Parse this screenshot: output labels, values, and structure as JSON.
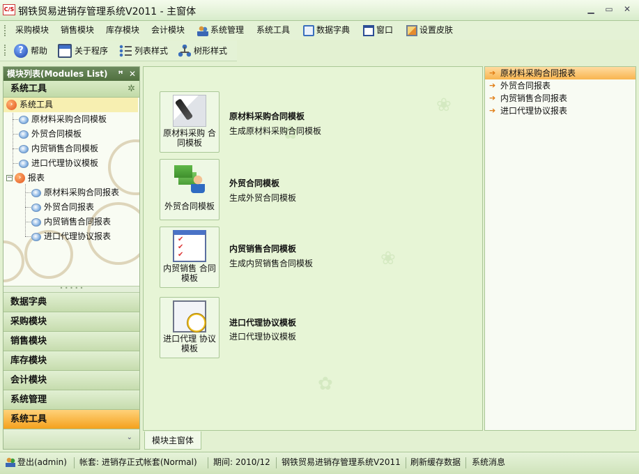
{
  "window": {
    "logo": "C/S",
    "title": "钢铁贸易进销存管理系统V2011 - 主窗体"
  },
  "menu": [
    {
      "label": "采购模块"
    },
    {
      "label": "销售模块"
    },
    {
      "label": "库存模块"
    },
    {
      "label": "会计模块"
    },
    {
      "label": "系统管理",
      "icon": "users-icon"
    },
    {
      "label": "系统工具"
    },
    {
      "label": "数据字典",
      "icon": "data-dictionary-icon"
    },
    {
      "label": "窗口",
      "icon": "window-icon"
    },
    {
      "label": "设置皮肤",
      "icon": "skin-icon"
    }
  ],
  "toolbar": [
    {
      "label": "帮助",
      "icon": "help-icon"
    },
    {
      "label": "关于程序",
      "icon": "about-icon"
    },
    {
      "label": "列表样式",
      "icon": "list-style-icon"
    },
    {
      "label": "树形样式",
      "icon": "tree-style-icon"
    }
  ],
  "module_list": {
    "header": "模块列表(Modules List)",
    "pin_glyph": "ꟸ",
    "close_glyph": "✕",
    "group_title": "系统工具",
    "tree": [
      {
        "label": "系统工具",
        "level": 0,
        "type": "folder",
        "selected": true
      },
      {
        "label": "原材料采购合同模板",
        "level": 1,
        "type": "leaf"
      },
      {
        "label": "外贸合同模板",
        "level": 1,
        "type": "leaf"
      },
      {
        "label": "内贸销售合同模板",
        "level": 1,
        "type": "leaf"
      },
      {
        "label": "进口代理协议模板",
        "level": 1,
        "type": "leaf"
      },
      {
        "label": "报表",
        "level": 0,
        "type": "folder",
        "expander": "−"
      },
      {
        "label": "原材料采购合同报表",
        "level": 2,
        "type": "leaf"
      },
      {
        "label": "外贸合同报表",
        "level": 2,
        "type": "leaf"
      },
      {
        "label": "内贸销售合同报表",
        "level": 2,
        "type": "leaf"
      },
      {
        "label": "进口代理协议报表",
        "level": 2,
        "type": "leaf"
      }
    ],
    "splitter": "• • • • •",
    "groups": [
      {
        "label": "数据字典",
        "active": false
      },
      {
        "label": "采购模块",
        "active": false
      },
      {
        "label": "销售模块",
        "active": false
      },
      {
        "label": "库存模块",
        "active": false
      },
      {
        "label": "会计模块",
        "active": false
      },
      {
        "label": "系统管理",
        "active": false
      },
      {
        "label": "系统工具",
        "active": true
      }
    ],
    "footer_glyph": "⌄"
  },
  "main": {
    "modules": [
      {
        "card_label": "原材料采购 合同模板",
        "title": "原材料采购合同模板",
        "desc": "生成原材料采购合同模板",
        "icon": "fountain-pen-icon"
      },
      {
        "card_label": "外贸合同模板",
        "title": "外贸合同模板",
        "desc": "生成外贸合同模板",
        "icon": "trade-contract-icon"
      },
      {
        "card_label": "内贸销售 合同模板",
        "title": "内贸销售合同模板",
        "desc": "生成内贸销售合同模板",
        "icon": "checklist-icon"
      },
      {
        "card_label": "进口代理 协议模板",
        "title": "进口代理协议模板",
        "desc": "进口代理协议模板",
        "icon": "document-clock-icon"
      }
    ],
    "tab": "模块主窗体"
  },
  "reports": {
    "arrow_glyph": "➔",
    "items": [
      {
        "label": "原材料采购合同报表",
        "selected": true
      },
      {
        "label": "外贸合同报表",
        "selected": false
      },
      {
        "label": "内贸销售合同报表",
        "selected": false
      },
      {
        "label": "进口代理协议报表",
        "selected": false
      }
    ]
  },
  "status": {
    "login": "登出(admin)",
    "account": "帐套: 进销存正式帐套(Normal)",
    "period": "期间: 2010/12",
    "system": "钢铁贸易进销存管理系统V2011",
    "refresh": "刷新缓存数据",
    "messages": "系统消息"
  },
  "colors": {
    "accent": "#f4a11d",
    "panel_header": "#50703f",
    "background": "#e3f1d2"
  }
}
